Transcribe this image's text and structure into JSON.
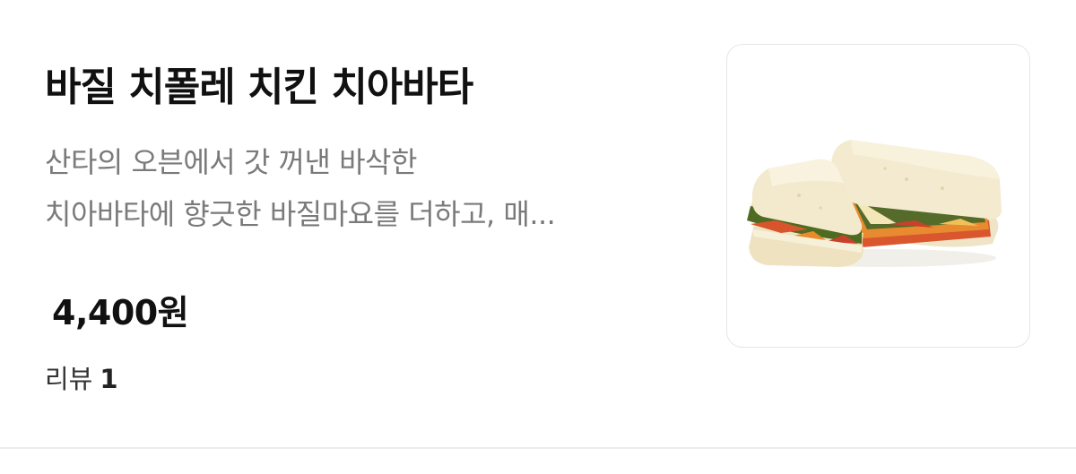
{
  "menu_item": {
    "title": "바질 치폴레 치킨 치아바타",
    "description_lines": [
      "산타의 오븐에서 갓 꺼낸 바삭한",
      "치아바타에 향긋한 바질마요를 더하고, 매..."
    ],
    "price": "4,400원",
    "review": {
      "label": "리뷰",
      "count": "1"
    },
    "image": {
      "icon": "sandwich-photo"
    }
  },
  "colors": {
    "title": "#111111",
    "description": "#7a7a7a",
    "border": "#e6e6e6",
    "divider": "#ececec"
  }
}
